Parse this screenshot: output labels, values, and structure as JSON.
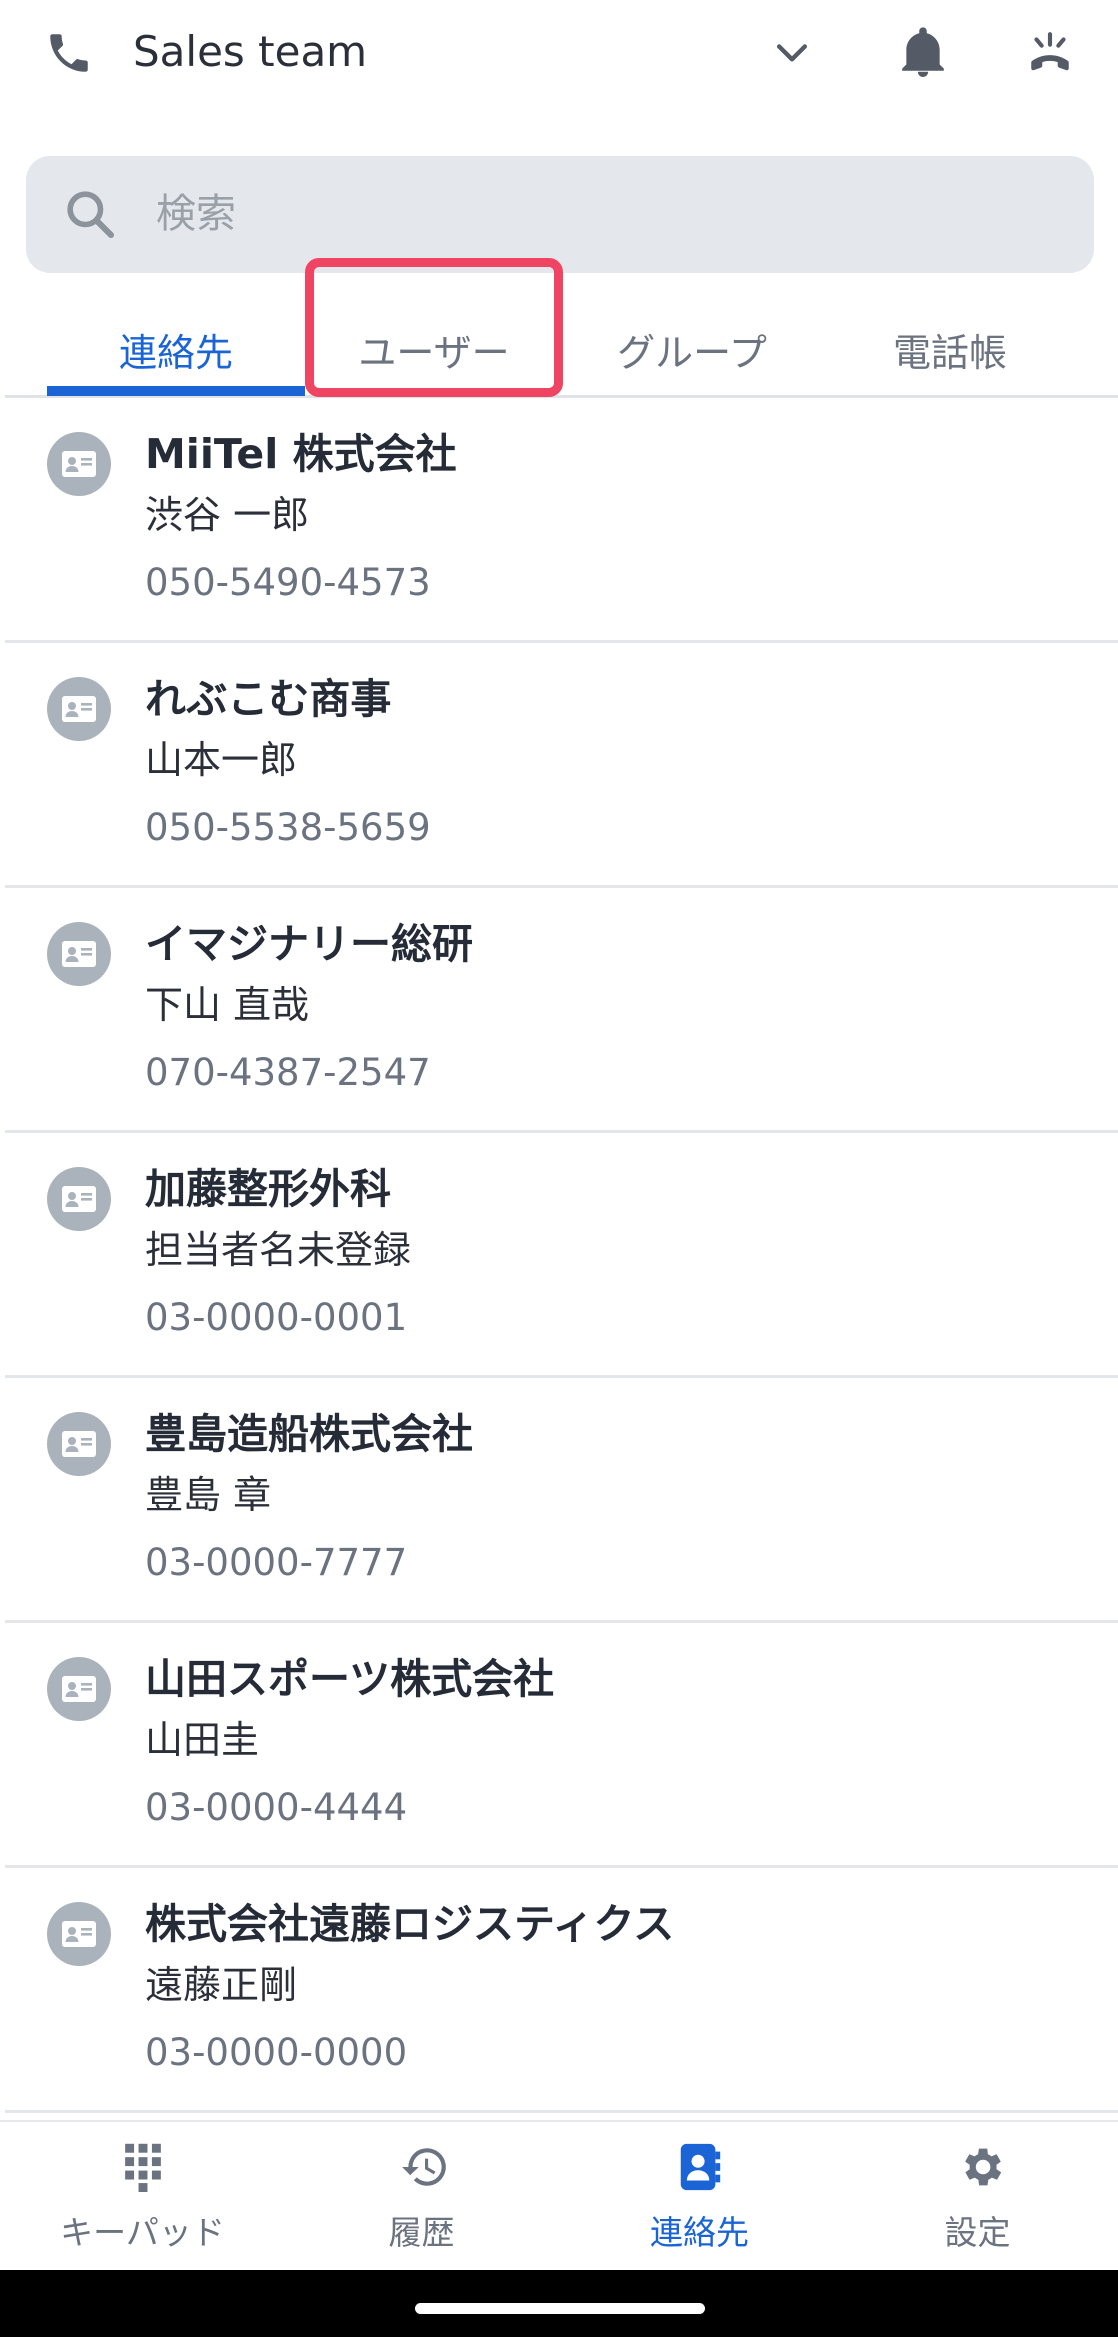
{
  "header": {
    "title": "Sales team",
    "icons": [
      "phone-icon",
      "chevron-down-icon",
      "bell-icon",
      "hang-up-icon"
    ]
  },
  "search": {
    "placeholder": "検索"
  },
  "tabs": [
    {
      "label": "連絡先",
      "active": true
    },
    {
      "label": "ユーザー",
      "active": false,
      "highlighted": true
    },
    {
      "label": "グループ",
      "active": false
    },
    {
      "label": "電話帳",
      "active": false
    }
  ],
  "contacts": [
    {
      "company": "MiiTel 株式会社",
      "person": "渋谷 一郎",
      "phone": "050-5490-4573"
    },
    {
      "company": "れぶこむ商事",
      "person": "山本一郎",
      "phone": "050-5538-5659"
    },
    {
      "company": "イマジナリー総研",
      "person": "下山 直哉",
      "phone": "070-4387-2547"
    },
    {
      "company": "加藤整形外科",
      "person": "担当者名未登録",
      "phone": "03-0000-0001"
    },
    {
      "company": "豊島造船株式会社",
      "person": "豊島 章",
      "phone": "03-0000-7777"
    },
    {
      "company": "山田スポーツ株式会社",
      "person": "山田圭",
      "phone": "03-0000-4444"
    },
    {
      "company": "株式会社遠藤ロジスティクス",
      "person": "遠藤正剛",
      "phone": "03-0000-0000"
    }
  ],
  "bottom_nav": [
    {
      "label": "キーパッド",
      "icon": "keypad-icon",
      "active": false
    },
    {
      "label": "履歴",
      "icon": "history-icon",
      "active": false
    },
    {
      "label": "連絡先",
      "icon": "contacts-icon",
      "active": true
    },
    {
      "label": "設定",
      "icon": "gear-icon",
      "active": false
    }
  ],
  "colors": {
    "accent": "#1a64d6",
    "highlight": "#ef4462",
    "search_bg": "#e4e7eb",
    "icon_gray": "#6b7280"
  }
}
